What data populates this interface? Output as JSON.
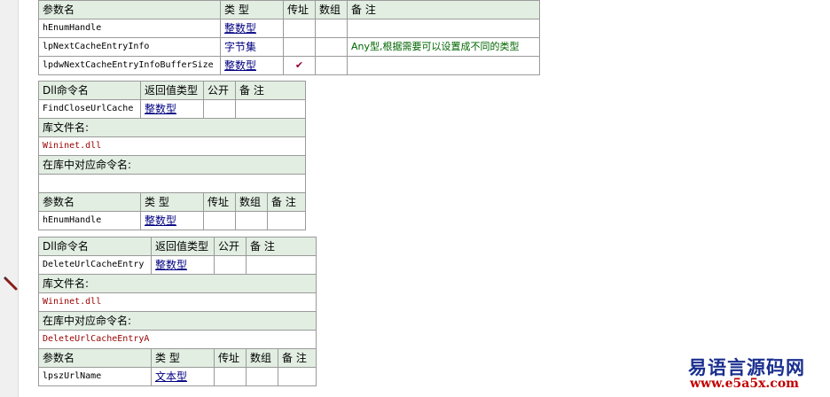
{
  "param_header": {
    "name": "参数名",
    "type": "类 型",
    "byref": "传址",
    "array": "数组",
    "note": "备 注"
  },
  "dll_header": {
    "cmd": "Dll命令名",
    "ret": "返回值类型",
    "public": "公开",
    "note": "备 注"
  },
  "lib_label": "库文件名:",
  "alias_label": "在库中对应命令名:",
  "table1": {
    "rows": [
      {
        "name": "hEnumHandle",
        "type": "整数型",
        "byref": "",
        "note": ""
      },
      {
        "name": "lpNextCacheEntryInfo",
        "type": "字节集",
        "byref": "",
        "note": "Any型,根据需要可以设置成不同的类型"
      },
      {
        "name": "lpdwNextCacheEntryInfoBufferSize",
        "type": "整数型",
        "byref": "✔",
        "note": ""
      }
    ]
  },
  "table2": {
    "cmd": "FindCloseUrlCache",
    "ret": "整数型",
    "lib": "Wininet.dll",
    "alias": "",
    "params": [
      {
        "name": "hEnumHandle",
        "type": "整数型"
      }
    ]
  },
  "table3": {
    "cmd": "DeleteUrlCacheEntry",
    "ret": "整数型",
    "lib": "Wininet.dll",
    "alias": "DeleteUrlCacheEntryA",
    "params": [
      {
        "name": "lpszUrlName",
        "type": "文本型"
      }
    ]
  },
  "watermark": {
    "title": "易语言源码网",
    "url": "www.e5a5x.com"
  }
}
